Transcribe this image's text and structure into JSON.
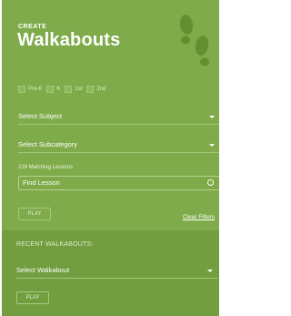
{
  "header": {
    "eyebrow": "CREATE",
    "title": "Walkabouts"
  },
  "grades": [
    {
      "label": "Pre-K",
      "checked": false
    },
    {
      "label": "K",
      "checked": false
    },
    {
      "label": "1st",
      "checked": false
    },
    {
      "label": "2nd",
      "checked": false
    }
  ],
  "filters": {
    "subject": "Select Subject",
    "subcategory": "Select Subcategory",
    "matching_count": "219 Matching Lessons",
    "find_placeholder": "Find Lesson",
    "play_label": "PLAY",
    "clear_label": "Clear Filters"
  },
  "recent": {
    "title": "RECENT WALKABOUTS:",
    "select": "Select Walkabout",
    "play_label": "PLAY"
  },
  "colors": {
    "panel": "#7fab4a",
    "recent_bg": "#729e3f",
    "footprints": "#62902f"
  },
  "icons": [
    "footprints-icon",
    "chevron-down-icon",
    "search-icon"
  ]
}
